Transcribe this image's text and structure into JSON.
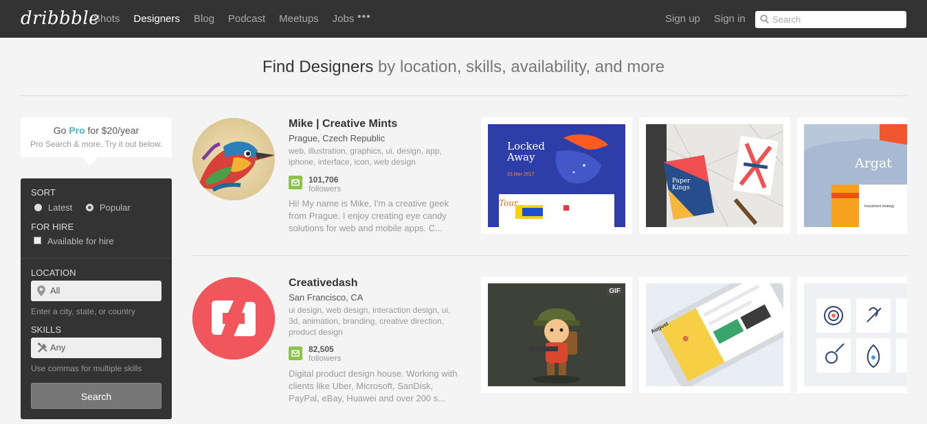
{
  "header": {
    "logo": "dribbble",
    "nav": [
      "Shots",
      "Designers",
      "Blog",
      "Podcast",
      "Meetups",
      "Jobs"
    ],
    "active_nav": "Designers",
    "more": "•••",
    "sign_up": "Sign up",
    "sign_in": "Sign in",
    "search_placeholder": "Search"
  },
  "heading": {
    "strong": "Find Designers",
    "light": "by location, skills, availability, and more"
  },
  "promo": {
    "prefix": "Go",
    "pro": "Pro",
    "suffix": "for $20/year",
    "subtitle": "Pro Search & more. Try it out below."
  },
  "filters": {
    "sort_label": "SORT",
    "sort_options": [
      "Latest",
      "Popular"
    ],
    "sort_selected": "Popular",
    "for_hire_label": "FOR HIRE",
    "available_label": "Available for hire",
    "location_label": "LOCATION",
    "location_value": "All",
    "location_hint": "Enter a city, state, or country",
    "skills_label": "SKILLS",
    "skills_value": "Any",
    "skills_hint": "Use commas for multiple skills",
    "search_button": "Search"
  },
  "designers": [
    {
      "name": "Mike | Creative Mints",
      "location": "Prague, Czech Republic",
      "skills": "web, illustration, graphics, ui, design, app, iphone, interface, icon, web design",
      "followers": "101,706",
      "followers_label": "followers",
      "bio": "Hi! My name is Mike, I'm a creative geek from Prague. I enjoy creating eye candy solutions for web and mobile apps. C...",
      "shots": [
        {
          "title": "Locked Away",
          "subtitle": "23 Mar 2017",
          "brand": "Tour"
        },
        {
          "title": "Paper Kings"
        },
        {
          "title": "Argat",
          "subtitle": "Investment strategy"
        }
      ]
    },
    {
      "name": "Creativedash",
      "location": "San Francisco, CA",
      "skills": "ui design, web design, interaction design, ui, 3d, animation, branding, creative direction, product design",
      "followers": "82,505",
      "followers_label": "followers",
      "bio": "Digital product design house. Working with clients like Uber, Microsoft, SanDisk, PayPal, eBay, Huawei and over 200 s...",
      "shots": [
        {
          "badge": "GIF"
        },
        {
          "title": "August"
        },
        {}
      ]
    }
  ],
  "colors": {
    "topbar": "#333333",
    "pro_accent": "#4ab3c7",
    "follower_badge": "#8bc34a",
    "creativedash_red": "#f0565b"
  }
}
